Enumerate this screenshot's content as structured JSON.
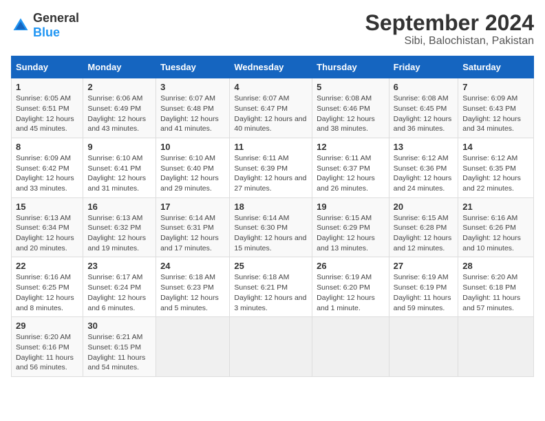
{
  "logo": {
    "text_general": "General",
    "text_blue": "Blue"
  },
  "title": "September 2024",
  "subtitle": "Sibi, Balochistan, Pakistan",
  "days_of_week": [
    "Sunday",
    "Monday",
    "Tuesday",
    "Wednesday",
    "Thursday",
    "Friday",
    "Saturday"
  ],
  "weeks": [
    [
      {
        "day": "1",
        "sunrise": "Sunrise: 6:05 AM",
        "sunset": "Sunset: 6:51 PM",
        "daylight": "Daylight: 12 hours and 45 minutes."
      },
      {
        "day": "2",
        "sunrise": "Sunrise: 6:06 AM",
        "sunset": "Sunset: 6:49 PM",
        "daylight": "Daylight: 12 hours and 43 minutes."
      },
      {
        "day": "3",
        "sunrise": "Sunrise: 6:07 AM",
        "sunset": "Sunset: 6:48 PM",
        "daylight": "Daylight: 12 hours and 41 minutes."
      },
      {
        "day": "4",
        "sunrise": "Sunrise: 6:07 AM",
        "sunset": "Sunset: 6:47 PM",
        "daylight": "Daylight: 12 hours and 40 minutes."
      },
      {
        "day": "5",
        "sunrise": "Sunrise: 6:08 AM",
        "sunset": "Sunset: 6:46 PM",
        "daylight": "Daylight: 12 hours and 38 minutes."
      },
      {
        "day": "6",
        "sunrise": "Sunrise: 6:08 AM",
        "sunset": "Sunset: 6:45 PM",
        "daylight": "Daylight: 12 hours and 36 minutes."
      },
      {
        "day": "7",
        "sunrise": "Sunrise: 6:09 AM",
        "sunset": "Sunset: 6:43 PM",
        "daylight": "Daylight: 12 hours and 34 minutes."
      }
    ],
    [
      {
        "day": "8",
        "sunrise": "Sunrise: 6:09 AM",
        "sunset": "Sunset: 6:42 PM",
        "daylight": "Daylight: 12 hours and 33 minutes."
      },
      {
        "day": "9",
        "sunrise": "Sunrise: 6:10 AM",
        "sunset": "Sunset: 6:41 PM",
        "daylight": "Daylight: 12 hours and 31 minutes."
      },
      {
        "day": "10",
        "sunrise": "Sunrise: 6:10 AM",
        "sunset": "Sunset: 6:40 PM",
        "daylight": "Daylight: 12 hours and 29 minutes."
      },
      {
        "day": "11",
        "sunrise": "Sunrise: 6:11 AM",
        "sunset": "Sunset: 6:39 PM",
        "daylight": "Daylight: 12 hours and 27 minutes."
      },
      {
        "day": "12",
        "sunrise": "Sunrise: 6:11 AM",
        "sunset": "Sunset: 6:37 PM",
        "daylight": "Daylight: 12 hours and 26 minutes."
      },
      {
        "day": "13",
        "sunrise": "Sunrise: 6:12 AM",
        "sunset": "Sunset: 6:36 PM",
        "daylight": "Daylight: 12 hours and 24 minutes."
      },
      {
        "day": "14",
        "sunrise": "Sunrise: 6:12 AM",
        "sunset": "Sunset: 6:35 PM",
        "daylight": "Daylight: 12 hours and 22 minutes."
      }
    ],
    [
      {
        "day": "15",
        "sunrise": "Sunrise: 6:13 AM",
        "sunset": "Sunset: 6:34 PM",
        "daylight": "Daylight: 12 hours and 20 minutes."
      },
      {
        "day": "16",
        "sunrise": "Sunrise: 6:13 AM",
        "sunset": "Sunset: 6:32 PM",
        "daylight": "Daylight: 12 hours and 19 minutes."
      },
      {
        "day": "17",
        "sunrise": "Sunrise: 6:14 AM",
        "sunset": "Sunset: 6:31 PM",
        "daylight": "Daylight: 12 hours and 17 minutes."
      },
      {
        "day": "18",
        "sunrise": "Sunrise: 6:14 AM",
        "sunset": "Sunset: 6:30 PM",
        "daylight": "Daylight: 12 hours and 15 minutes."
      },
      {
        "day": "19",
        "sunrise": "Sunrise: 6:15 AM",
        "sunset": "Sunset: 6:29 PM",
        "daylight": "Daylight: 12 hours and 13 minutes."
      },
      {
        "day": "20",
        "sunrise": "Sunrise: 6:15 AM",
        "sunset": "Sunset: 6:28 PM",
        "daylight": "Daylight: 12 hours and 12 minutes."
      },
      {
        "day": "21",
        "sunrise": "Sunrise: 6:16 AM",
        "sunset": "Sunset: 6:26 PM",
        "daylight": "Daylight: 12 hours and 10 minutes."
      }
    ],
    [
      {
        "day": "22",
        "sunrise": "Sunrise: 6:16 AM",
        "sunset": "Sunset: 6:25 PM",
        "daylight": "Daylight: 12 hours and 8 minutes."
      },
      {
        "day": "23",
        "sunrise": "Sunrise: 6:17 AM",
        "sunset": "Sunset: 6:24 PM",
        "daylight": "Daylight: 12 hours and 6 minutes."
      },
      {
        "day": "24",
        "sunrise": "Sunrise: 6:18 AM",
        "sunset": "Sunset: 6:23 PM",
        "daylight": "Daylight: 12 hours and 5 minutes."
      },
      {
        "day": "25",
        "sunrise": "Sunrise: 6:18 AM",
        "sunset": "Sunset: 6:21 PM",
        "daylight": "Daylight: 12 hours and 3 minutes."
      },
      {
        "day": "26",
        "sunrise": "Sunrise: 6:19 AM",
        "sunset": "Sunset: 6:20 PM",
        "daylight": "Daylight: 12 hours and 1 minute."
      },
      {
        "day": "27",
        "sunrise": "Sunrise: 6:19 AM",
        "sunset": "Sunset: 6:19 PM",
        "daylight": "Daylight: 11 hours and 59 minutes."
      },
      {
        "day": "28",
        "sunrise": "Sunrise: 6:20 AM",
        "sunset": "Sunset: 6:18 PM",
        "daylight": "Daylight: 11 hours and 57 minutes."
      }
    ],
    [
      {
        "day": "29",
        "sunrise": "Sunrise: 6:20 AM",
        "sunset": "Sunset: 6:16 PM",
        "daylight": "Daylight: 11 hours and 56 minutes."
      },
      {
        "day": "30",
        "sunrise": "Sunrise: 6:21 AM",
        "sunset": "Sunset: 6:15 PM",
        "daylight": "Daylight: 11 hours and 54 minutes."
      },
      null,
      null,
      null,
      null,
      null
    ]
  ]
}
